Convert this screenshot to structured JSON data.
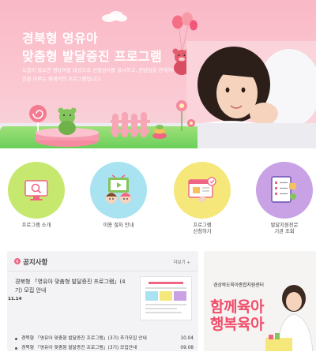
{
  "hero": {
    "title_line1": "경북형 영유아",
    "title_line2": "맞춤형 발달증진 프로그램",
    "description": "도움이 필요한 영유아를 대상으로 선별검사를 실시하고, 전담팀을 연계하여 발달증진을 이루는 체계적인 프로그램입니다."
  },
  "menu": [
    {
      "label": "프로그램 소개",
      "color": "#c7e86e",
      "icon": "monitor-search-icon"
    },
    {
      "label": "이용 절차 안내",
      "color": "#a9e3f2",
      "icon": "children-video-icon"
    },
    {
      "label": "프로그램\n신청하기",
      "color": "#f5e77a",
      "icon": "application-form-icon"
    },
    {
      "label": "발달지원전문\n기관 조회",
      "color": "#c9a2e6",
      "icon": "checklist-search-icon"
    }
  ],
  "notice": {
    "title": "공지사항",
    "more_label": "더보기 +",
    "feature_title": "경북형 「영유아 맞춤형 발달증진 프로그램」(4기) 모집 안내",
    "feature_date": "11.14",
    "items": [
      {
        "title": "경북형 「영유아 맞춤형 발달증진 프로그램」(3기) 추가모집 안내",
        "date": "10.04"
      },
      {
        "title": "경북형 「영유아 맞춤형 발달증진 프로그램」(3기) 모집안내",
        "date": "09.08"
      }
    ]
  },
  "banner": {
    "org_name": "경상북도육아종합지원센터",
    "line1": "함께육아",
    "line2": "행복육아"
  },
  "colors": {
    "hero_bg": "#f9b9c6",
    "accent_pink": "#f04d6a"
  }
}
